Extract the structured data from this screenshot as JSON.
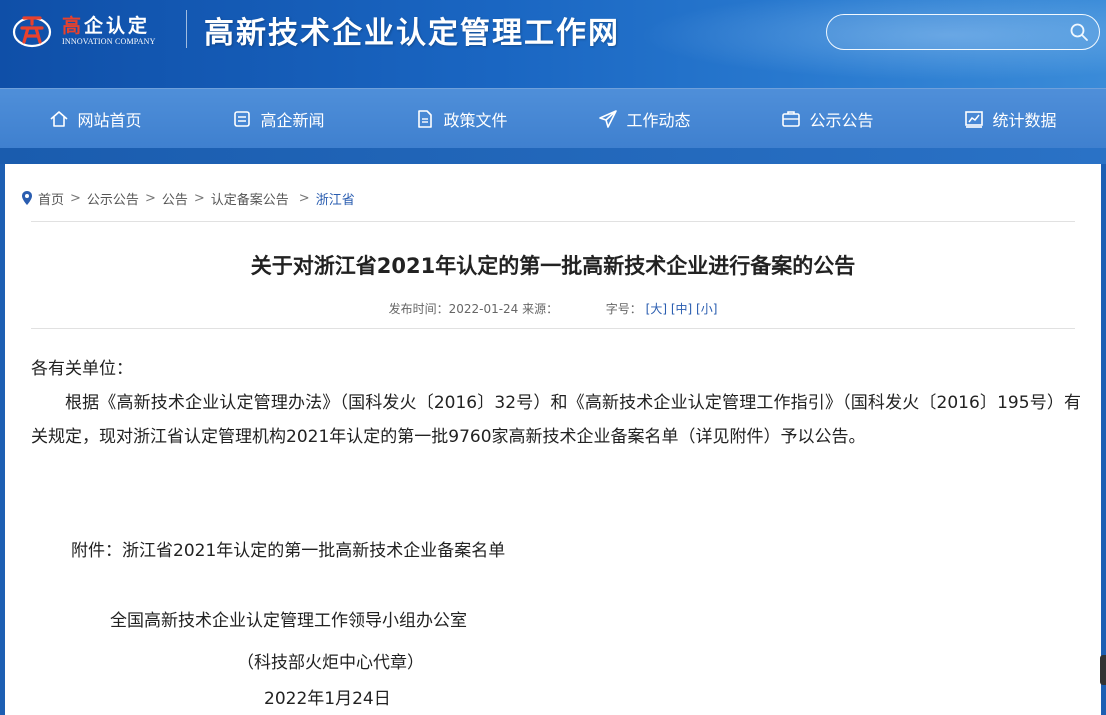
{
  "header": {
    "logo_cn_red": "高",
    "logo_cn_rest": "企认定",
    "logo_en": "INNOVATION COMPANY",
    "site_title": "高新技术企业认定管理工作网",
    "search_placeholder": "",
    "search_icon": "search-icon"
  },
  "nav": {
    "items": [
      {
        "label": "网站首页",
        "icon": "home-icon"
      },
      {
        "label": "高企新闻",
        "icon": "news-icon"
      },
      {
        "label": "政策文件",
        "icon": "document-icon"
      },
      {
        "label": "工作动态",
        "icon": "send-icon"
      },
      {
        "label": "公示公告",
        "icon": "briefcase-icon"
      },
      {
        "label": "统计数据",
        "icon": "chart-icon"
      }
    ]
  },
  "breadcrumb": {
    "items": [
      "首页",
      "公示公告",
      "公告",
      "认定备案公告"
    ],
    "current": "浙江省",
    "separator": ">"
  },
  "article": {
    "title": "关于对浙江省2021年认定的第一批高新技术企业进行备案的公告",
    "meta_date": "发布时间：2022-01-24 来源：",
    "meta_fontsize_label": "字号：",
    "font_sizes": [
      "[大]",
      "[中]",
      "[小]"
    ],
    "salutation": "各有关单位：",
    "paragraph": "根据《高新技术企业认定管理办法》（国科发火〔2016〕32号）和《高新技术企业认定管理工作指引》（国科发火〔2016〕195号）有关规定，现对浙江省认定管理机构2021年认定的第一批9760家高新技术企业备案名单（详见附件）予以公告。",
    "attachment": "附件：浙江省2021年认定的第一批高新技术企业备案名单",
    "signature_org": "全国高新技术企业认定管理工作领导小组办公室",
    "signature_note": "（科技部火炬中心代章）",
    "signature_date": "2022年1月24日"
  },
  "colors": {
    "header_blue": "#1a66c2",
    "nav_blue": "#4a8ad6",
    "link_blue": "#2a5db0",
    "logo_red": "#e8412c"
  }
}
